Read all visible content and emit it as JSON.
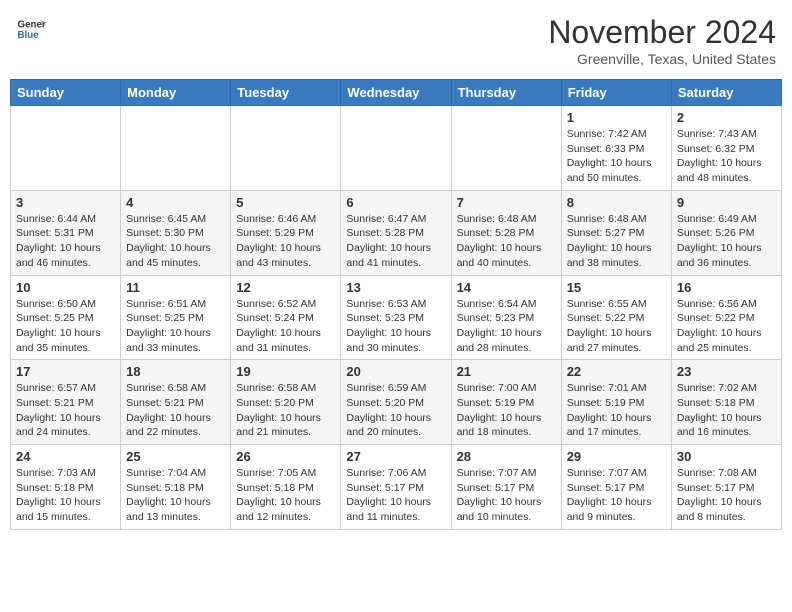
{
  "header": {
    "logo_general": "General",
    "logo_blue": "Blue",
    "month": "November 2024",
    "location": "Greenville, Texas, United States"
  },
  "days_of_week": [
    "Sunday",
    "Monday",
    "Tuesday",
    "Wednesday",
    "Thursday",
    "Friday",
    "Saturday"
  ],
  "weeks": [
    [
      {
        "day": "",
        "info": ""
      },
      {
        "day": "",
        "info": ""
      },
      {
        "day": "",
        "info": ""
      },
      {
        "day": "",
        "info": ""
      },
      {
        "day": "",
        "info": ""
      },
      {
        "day": "1",
        "info": "Sunrise: 7:42 AM\nSunset: 6:33 PM\nDaylight: 10 hours and 50 minutes."
      },
      {
        "day": "2",
        "info": "Sunrise: 7:43 AM\nSunset: 6:32 PM\nDaylight: 10 hours and 48 minutes."
      }
    ],
    [
      {
        "day": "3",
        "info": "Sunrise: 6:44 AM\nSunset: 5:31 PM\nDaylight: 10 hours and 46 minutes."
      },
      {
        "day": "4",
        "info": "Sunrise: 6:45 AM\nSunset: 5:30 PM\nDaylight: 10 hours and 45 minutes."
      },
      {
        "day": "5",
        "info": "Sunrise: 6:46 AM\nSunset: 5:29 PM\nDaylight: 10 hours and 43 minutes."
      },
      {
        "day": "6",
        "info": "Sunrise: 6:47 AM\nSunset: 5:28 PM\nDaylight: 10 hours and 41 minutes."
      },
      {
        "day": "7",
        "info": "Sunrise: 6:48 AM\nSunset: 5:28 PM\nDaylight: 10 hours and 40 minutes."
      },
      {
        "day": "8",
        "info": "Sunrise: 6:48 AM\nSunset: 5:27 PM\nDaylight: 10 hours and 38 minutes."
      },
      {
        "day": "9",
        "info": "Sunrise: 6:49 AM\nSunset: 5:26 PM\nDaylight: 10 hours and 36 minutes."
      }
    ],
    [
      {
        "day": "10",
        "info": "Sunrise: 6:50 AM\nSunset: 5:25 PM\nDaylight: 10 hours and 35 minutes."
      },
      {
        "day": "11",
        "info": "Sunrise: 6:51 AM\nSunset: 5:25 PM\nDaylight: 10 hours and 33 minutes."
      },
      {
        "day": "12",
        "info": "Sunrise: 6:52 AM\nSunset: 5:24 PM\nDaylight: 10 hours and 31 minutes."
      },
      {
        "day": "13",
        "info": "Sunrise: 6:53 AM\nSunset: 5:23 PM\nDaylight: 10 hours and 30 minutes."
      },
      {
        "day": "14",
        "info": "Sunrise: 6:54 AM\nSunset: 5:23 PM\nDaylight: 10 hours and 28 minutes."
      },
      {
        "day": "15",
        "info": "Sunrise: 6:55 AM\nSunset: 5:22 PM\nDaylight: 10 hours and 27 minutes."
      },
      {
        "day": "16",
        "info": "Sunrise: 6:56 AM\nSunset: 5:22 PM\nDaylight: 10 hours and 25 minutes."
      }
    ],
    [
      {
        "day": "17",
        "info": "Sunrise: 6:57 AM\nSunset: 5:21 PM\nDaylight: 10 hours and 24 minutes."
      },
      {
        "day": "18",
        "info": "Sunrise: 6:58 AM\nSunset: 5:21 PM\nDaylight: 10 hours and 22 minutes."
      },
      {
        "day": "19",
        "info": "Sunrise: 6:58 AM\nSunset: 5:20 PM\nDaylight: 10 hours and 21 minutes."
      },
      {
        "day": "20",
        "info": "Sunrise: 6:59 AM\nSunset: 5:20 PM\nDaylight: 10 hours and 20 minutes."
      },
      {
        "day": "21",
        "info": "Sunrise: 7:00 AM\nSunset: 5:19 PM\nDaylight: 10 hours and 18 minutes."
      },
      {
        "day": "22",
        "info": "Sunrise: 7:01 AM\nSunset: 5:19 PM\nDaylight: 10 hours and 17 minutes."
      },
      {
        "day": "23",
        "info": "Sunrise: 7:02 AM\nSunset: 5:18 PM\nDaylight: 10 hours and 16 minutes."
      }
    ],
    [
      {
        "day": "24",
        "info": "Sunrise: 7:03 AM\nSunset: 5:18 PM\nDaylight: 10 hours and 15 minutes."
      },
      {
        "day": "25",
        "info": "Sunrise: 7:04 AM\nSunset: 5:18 PM\nDaylight: 10 hours and 13 minutes."
      },
      {
        "day": "26",
        "info": "Sunrise: 7:05 AM\nSunset: 5:18 PM\nDaylight: 10 hours and 12 minutes."
      },
      {
        "day": "27",
        "info": "Sunrise: 7:06 AM\nSunset: 5:17 PM\nDaylight: 10 hours and 11 minutes."
      },
      {
        "day": "28",
        "info": "Sunrise: 7:07 AM\nSunset: 5:17 PM\nDaylight: 10 hours and 10 minutes."
      },
      {
        "day": "29",
        "info": "Sunrise: 7:07 AM\nSunset: 5:17 PM\nDaylight: 10 hours and 9 minutes."
      },
      {
        "day": "30",
        "info": "Sunrise: 7:08 AM\nSunset: 5:17 PM\nDaylight: 10 hours and 8 minutes."
      }
    ]
  ]
}
